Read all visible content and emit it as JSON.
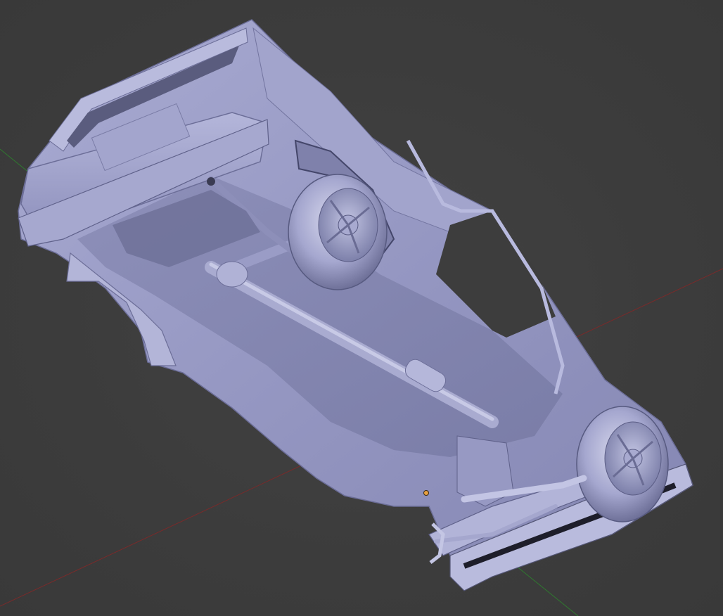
{
  "viewport": {
    "background_color": "#3d3d3d",
    "model_color": "#9a9cc8",
    "model_shadow_color": "#5e6084",
    "model_highlight_color": "#c9cbe6",
    "x_axis_color": "#7a2a2a",
    "y_axis_color": "#2f7a2f",
    "origin_color": "#e8a040"
  },
  "scene": {
    "object": "vehicle-model-underside",
    "x_axis_visible": true,
    "y_axis_visible": true,
    "origin_marker_visible": true
  }
}
